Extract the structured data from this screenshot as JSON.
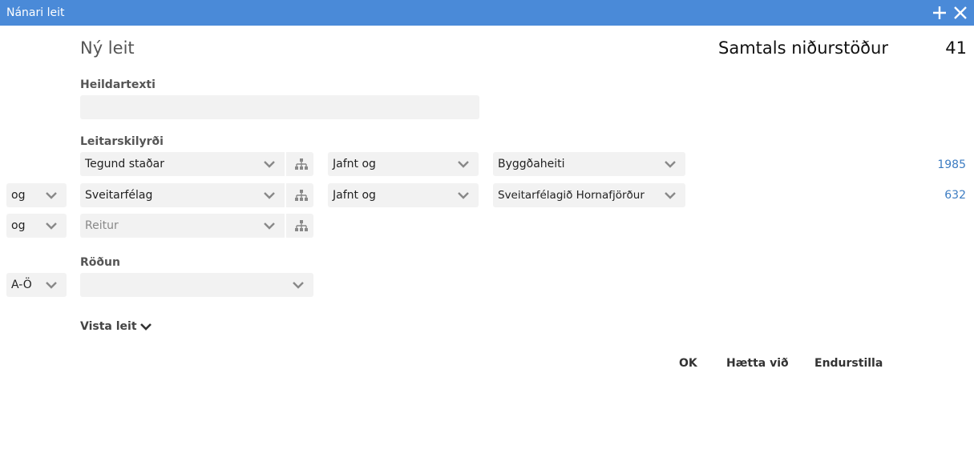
{
  "window": {
    "title": "Nánari leit",
    "add_icon": "plus-icon",
    "close_icon": "close-icon",
    "accent_color": "#4a8ad8"
  },
  "search": {
    "heading": "Ný leit",
    "total_label": "Samtals niðurstöður",
    "total_value": "41"
  },
  "fulltext": {
    "label": "Heildartexti",
    "value": ""
  },
  "conditions": {
    "label": "Leitarskilyrði",
    "rows": [
      {
        "connector": "",
        "field": "Tegund staðar",
        "operator": "Jafnt og",
        "value": "Byggðaheiti",
        "count": "1985"
      },
      {
        "connector": "og",
        "field": "Sveitarfélag",
        "operator": "Jafnt og",
        "value": "Sveitarfélagið Hornafjörður",
        "count": "632"
      },
      {
        "connector": "og",
        "field_placeholder": "Reitur"
      }
    ]
  },
  "sort": {
    "label": "Röðun",
    "direction": "A-Ö",
    "field": ""
  },
  "save": {
    "label": "Vista leit"
  },
  "actions": {
    "ok": "OK",
    "cancel": "Hætta við",
    "reset": "Endurstilla"
  },
  "link_color": "#3c7cc2"
}
